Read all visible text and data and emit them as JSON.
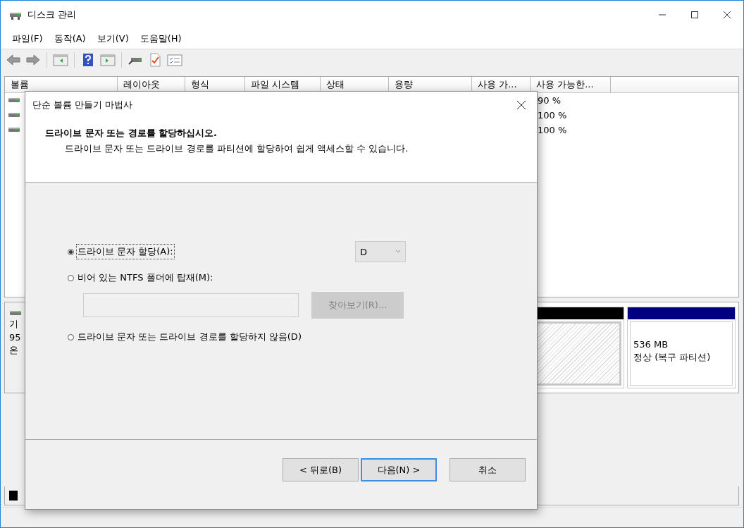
{
  "window": {
    "title": "디스크 관리"
  },
  "menu": [
    {
      "label": "파일(F)"
    },
    {
      "label": "동작(A)"
    },
    {
      "label": "보기(V)"
    },
    {
      "label": "도움말(H)"
    }
  ],
  "volume_table": {
    "columns": [
      "볼륨",
      "레이아웃",
      "형식",
      "파일 시스템",
      "상태",
      "용량",
      "사용 가...",
      "사용 가능한..."
    ],
    "rows": [
      {
        "percent_free": "90 %"
      },
      {
        "percent_free": "100 %"
      },
      {
        "percent_free": "100 %"
      }
    ]
  },
  "disk_pane": {
    "disk_label_lines": [
      "기",
      "95",
      "온"
    ],
    "partitions": [
      {
        "kind": "unallocated",
        "color": "#000000"
      },
      {
        "kind": "volume",
        "color": "#000080",
        "lines": [
          "536 MB",
          "정상 (복구 파티션)"
        ]
      }
    ],
    "legend": [
      {
        "color": "#000000"
      }
    ]
  },
  "dialog": {
    "title": "단순 볼륨 만들기 마법사",
    "heading": "드라이브 문자 또는 경로를 할당하십시오.",
    "subheading": "드라이브 문자 또는 드라이브 경로를 파티션에 할당하여 쉽게 액세스할 수 있습니다.",
    "options": [
      {
        "kind": "letter",
        "label": "드라이브 문자 할당(A):",
        "selected": true
      },
      {
        "kind": "folder",
        "label": "비어 있는 NTFS 폴더에 탑재(M):",
        "selected": false
      },
      {
        "kind": "none",
        "label": "드라이브 문자 또는 드라이브 경로를 할당하지 않음(D)",
        "selected": false
      }
    ],
    "drive_letter": {
      "value": "D"
    },
    "browse_button": {
      "label": "찾아보기(R)...",
      "disabled": true
    },
    "buttons": [
      {
        "label": "< 뒤로(B)",
        "focused": false
      },
      {
        "label": "다음(N) >",
        "focused": true
      },
      {
        "label": "취소",
        "focused": false
      }
    ]
  }
}
